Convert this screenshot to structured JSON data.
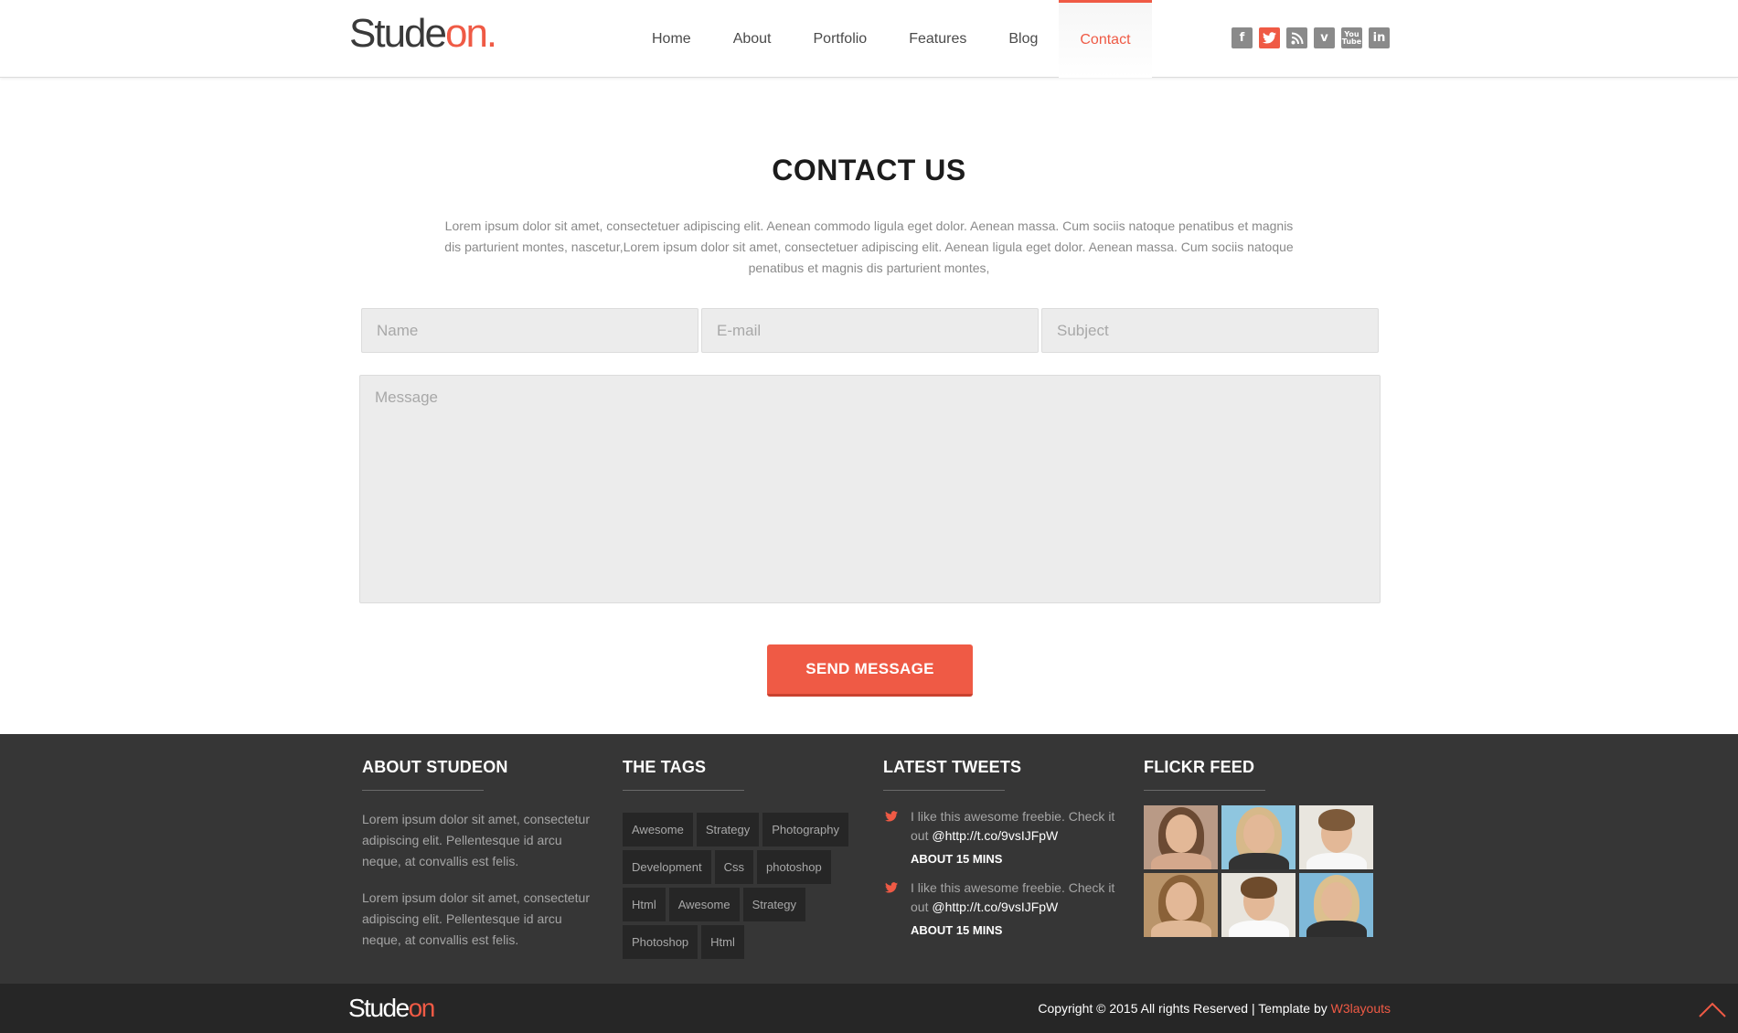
{
  "header": {
    "logo_main": "Stude",
    "logo_accent": "on.",
    "nav": [
      {
        "label": "Home"
      },
      {
        "label": "About"
      },
      {
        "label": "Portfolio"
      },
      {
        "label": "Features"
      },
      {
        "label": "Blog"
      },
      {
        "label": "Contact",
        "active": true
      }
    ],
    "social": [
      {
        "icon": "facebook-icon",
        "glyph": "f"
      },
      {
        "icon": "twitter-icon",
        "glyph": "t"
      },
      {
        "icon": "rss-icon",
        "glyph": "⟋"
      },
      {
        "icon": "vimeo-icon",
        "glyph": "v"
      },
      {
        "icon": "youtube-icon",
        "glyph": "You Tube"
      },
      {
        "icon": "linkedin-icon",
        "glyph": "in"
      }
    ]
  },
  "contact": {
    "title": "CONTACT US",
    "description": "Lorem ipsum dolor sit amet, consectetuer adipiscing elit. Aenean commodo ligula eget dolor. Aenean massa. Cum sociis natoque penatibus et magnis dis parturient montes, nascetur,Lorem ipsum dolor sit amet, consectetuer adipiscing elit. Aenean ligula eget dolor. Aenean massa. Cum sociis natoque penatibus et magnis dis parturient montes,",
    "name_placeholder": "Name",
    "email_placeholder": "E-mail",
    "subject_placeholder": "Subject",
    "message_placeholder": "Message",
    "send_label": "SEND MESSAGE"
  },
  "footer": {
    "about": {
      "heading": "ABOUT STUDEON",
      "p1": "Lorem ipsum dolor sit amet, consectetur adipiscing elit. Pellentesque id arcu neque, at convallis est felis.",
      "p2": "Lorem ipsum dolor sit amet, consectetur adipiscing elit. Pellentesque id arcu neque, at convallis est felis."
    },
    "tags": {
      "heading": "THE TAGS",
      "items": [
        "Awesome",
        "Strategy",
        "Photography",
        "Development",
        "Css",
        "photoshop",
        "Html",
        "Awesome",
        "Strategy",
        "Photoshop",
        "Html"
      ]
    },
    "tweets": {
      "heading": "LATEST TWEETS",
      "items": [
        {
          "text": "I like this awesome freebie. Check it out ",
          "link": "@http://t.co/9vsIJFpW",
          "time": "ABOUT 15 MINS"
        },
        {
          "text": "I like this awesome freebie. Check it out ",
          "link": "@http://t.co/9vsIJFpW",
          "time": "ABOUT 15 MINS"
        }
      ]
    },
    "flickr": {
      "heading": "FLICKR FEED"
    },
    "bottom": {
      "logo_main": "Stude",
      "logo_accent": "on",
      "copyright": "Copyright © 2015 All rights Reserved | Template by ",
      "credit": "W3layouts"
    }
  },
  "colors": {
    "accent": "#ef5a45",
    "footer_bg": "#363636",
    "bottom_bg": "#262626"
  }
}
